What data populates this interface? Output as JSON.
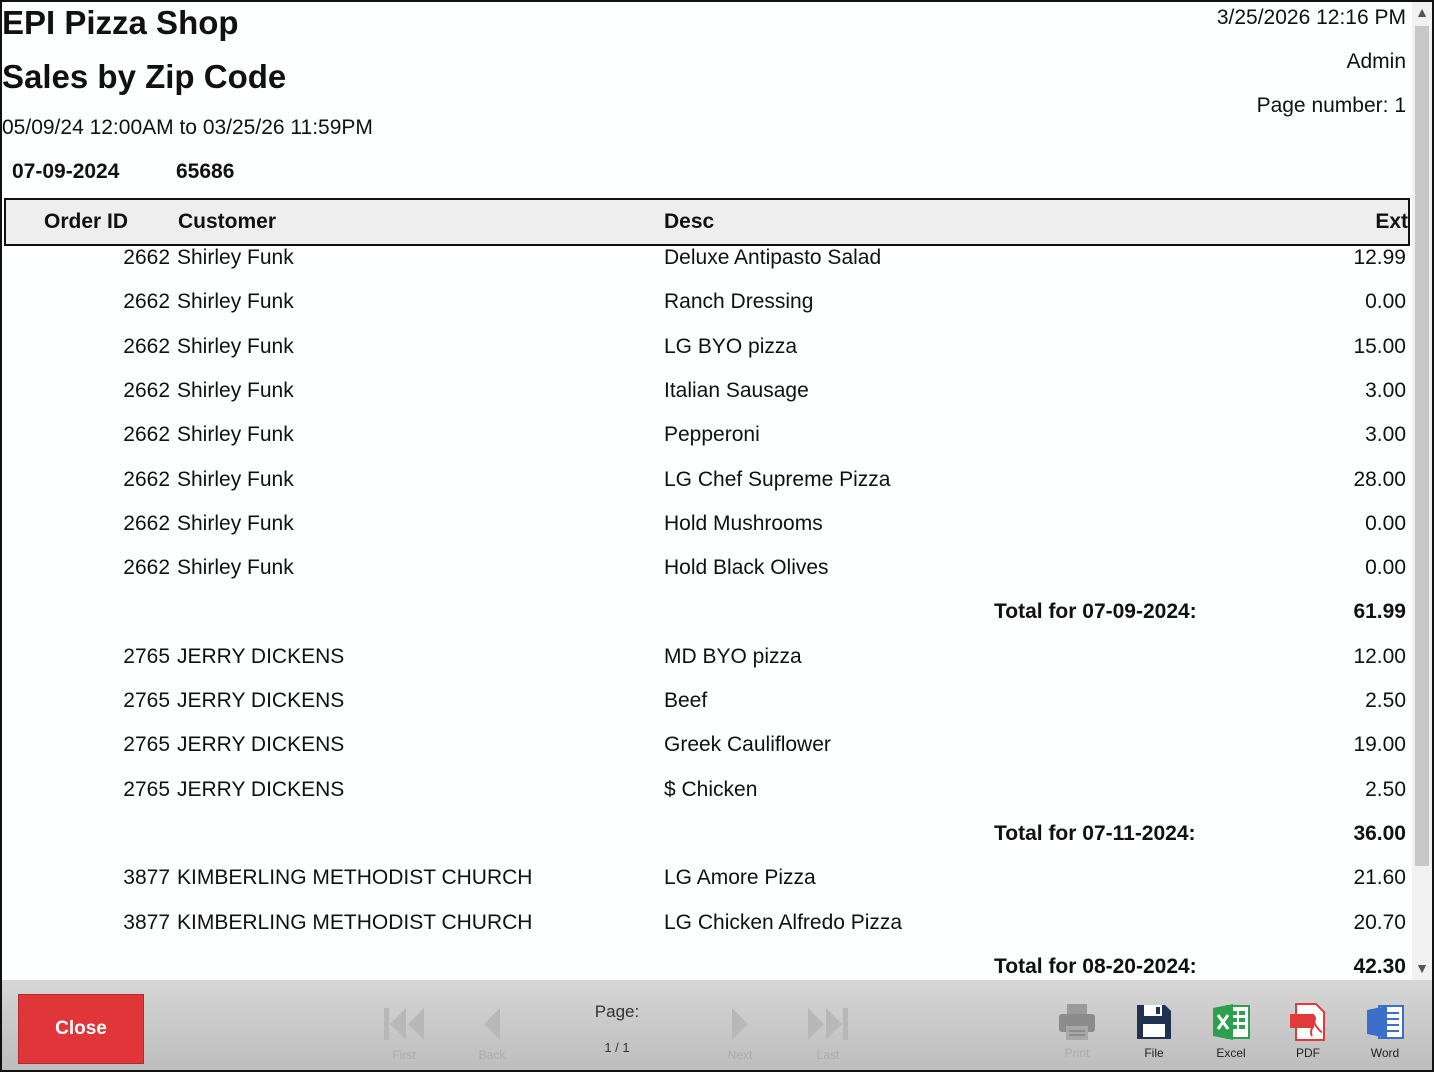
{
  "header": {
    "shop_name": "EPI Pizza Shop",
    "report_title": "Sales by Zip Code",
    "date_range": "05/09/24 12:00AM to 03/25/26 11:59PM",
    "print_datetime": "3/25/2026 12:16 PM",
    "user": "Admin",
    "page_number": "Page number: 1"
  },
  "group": {
    "date": "07-09-2024",
    "zip": "65686"
  },
  "columns": {
    "order_id": "Order ID",
    "customer": "Customer",
    "desc": "Desc",
    "ext": "Ext"
  },
  "rows": [
    {
      "order_id": "2662",
      "customer": "Shirley Funk",
      "desc": "Deluxe Antipasto Salad",
      "ext": "12.99"
    },
    {
      "order_id": "2662",
      "customer": "Shirley Funk",
      "desc": "Ranch Dressing",
      "ext": "0.00"
    },
    {
      "order_id": "2662",
      "customer": "Shirley Funk",
      "desc": "LG BYO pizza",
      "ext": "15.00"
    },
    {
      "order_id": "2662",
      "customer": "Shirley Funk",
      "desc": "Italian Sausage",
      "ext": "3.00"
    },
    {
      "order_id": "2662",
      "customer": "Shirley Funk",
      "desc": "Pepperoni",
      "ext": "3.00"
    },
    {
      "order_id": "2662",
      "customer": "Shirley Funk",
      "desc": "LG Chef Supreme Pizza",
      "ext": "28.00"
    },
    {
      "order_id": "2662",
      "customer": "Shirley Funk",
      "desc": "Hold Mushrooms",
      "ext": "0.00"
    },
    {
      "order_id": "2662",
      "customer": "Shirley Funk",
      "desc": "Hold Black Olives",
      "ext": "0.00"
    },
    {
      "total_label": "Total for 07-09-2024:",
      "total": "61.99"
    },
    {
      "order_id": "2765",
      "customer": "JERRY DICKENS",
      "desc": "MD BYO pizza",
      "ext": "12.00"
    },
    {
      "order_id": "2765",
      "customer": "JERRY DICKENS",
      "desc": "Beef",
      "ext": "2.50"
    },
    {
      "order_id": "2765",
      "customer": "JERRY DICKENS",
      "desc": "Greek Cauliflower",
      "ext": "19.00"
    },
    {
      "order_id": "2765",
      "customer": "JERRY DICKENS",
      "desc": "$ Chicken",
      "ext": "2.50"
    },
    {
      "total_label": "Total for 07-11-2024:",
      "total": "36.00"
    },
    {
      "order_id": "3877",
      "customer": "KIMBERLING METHODIST CHURCH",
      "desc": "LG Amore Pizza",
      "ext": "21.60"
    },
    {
      "order_id": "3877",
      "customer": "KIMBERLING METHODIST CHURCH",
      "desc": "LG Chicken Alfredo Pizza",
      "ext": "20.70"
    },
    {
      "total_label": "Total for 08-20-2024:",
      "total": "42.30"
    }
  ],
  "toolbar": {
    "close_label": "Close",
    "first_label": "First",
    "back_label": "Back",
    "page_label": "Page:",
    "page_value": "1 / 1",
    "next_label": "Next",
    "last_label": "Last",
    "print_label": "Print",
    "file_label": "File",
    "excel_label": "Excel",
    "pdf_label": "PDF",
    "word_label": "Word"
  },
  "colors": {
    "close": "#e0363a",
    "excel": "#2e9e4f",
    "pdf": "#e03a3a",
    "word": "#3b6fc9",
    "file": "#1f3350"
  }
}
